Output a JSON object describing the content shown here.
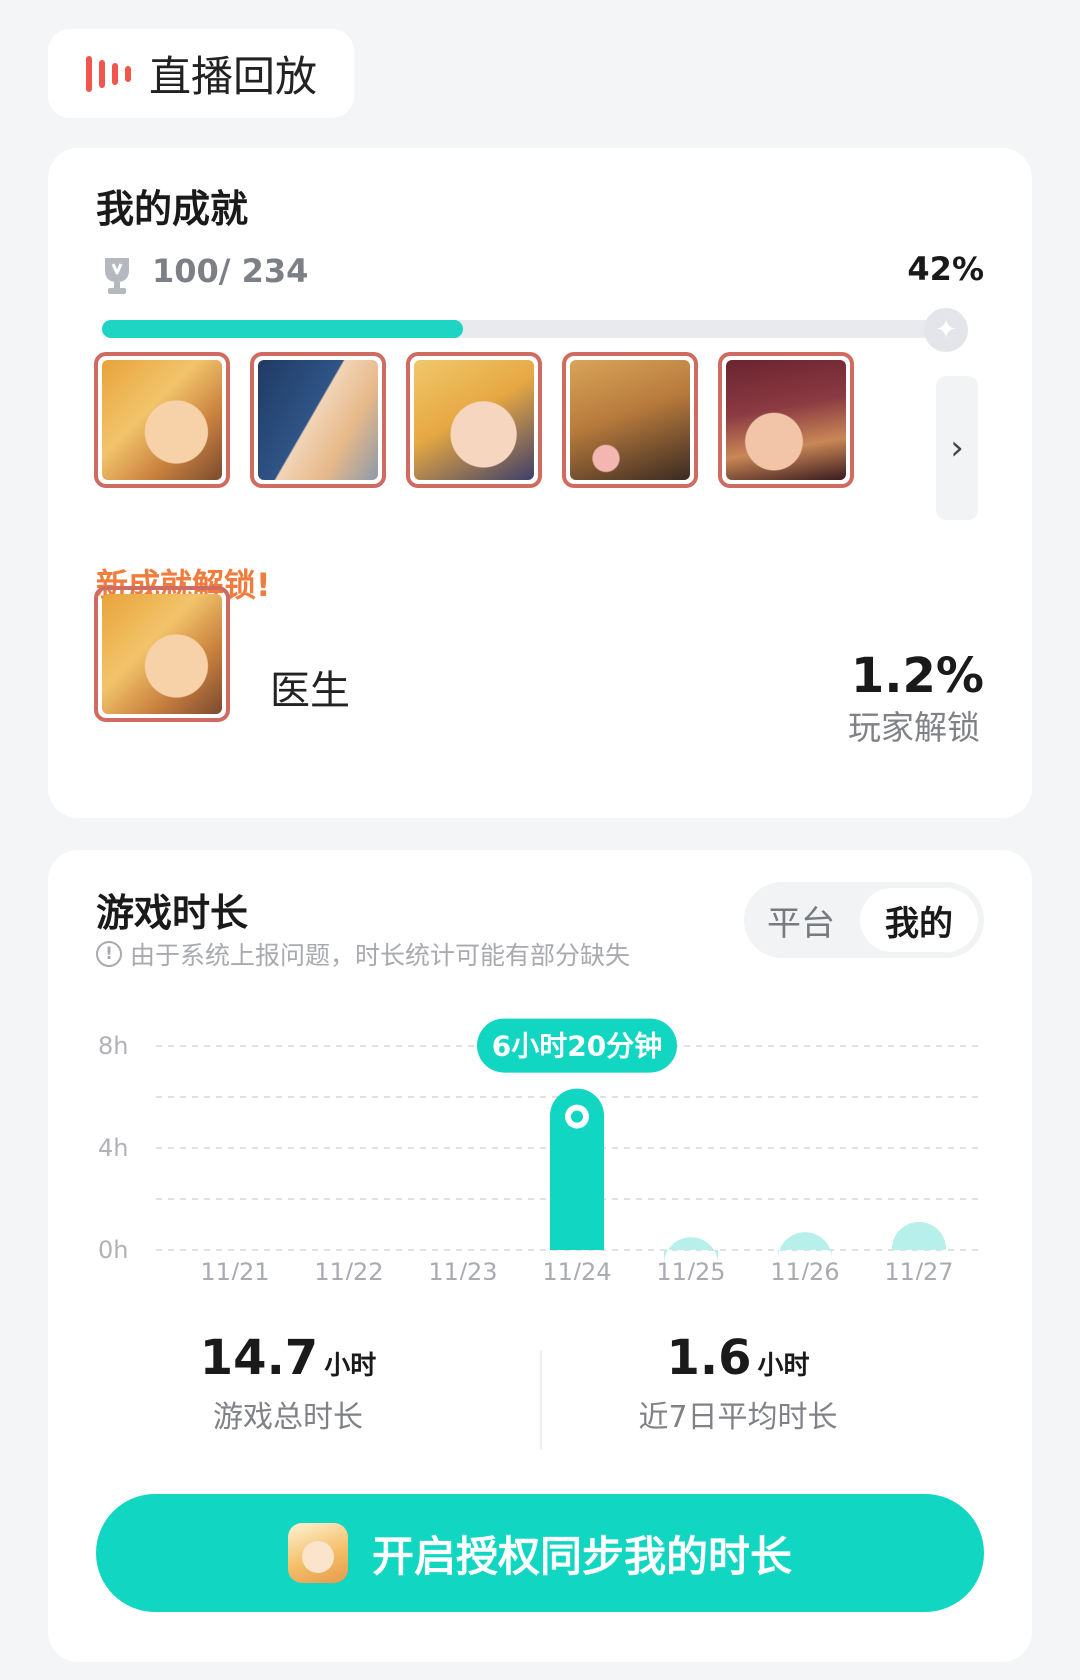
{
  "replay": {
    "label": "直播回放",
    "icon": "live-bars-icon",
    "accent": "#f2554d"
  },
  "achievements": {
    "title": "我的成就",
    "count": "100/ 234",
    "percent_label": "42%",
    "progress": 0.42,
    "progress_color": "#1ed4c2",
    "thumbnails": [
      "achievement-1",
      "achievement-2",
      "achievement-3",
      "achievement-4",
      "achievement-5"
    ],
    "new_unlock": {
      "heading": "新成就解锁!",
      "name": "医生",
      "rate": "1.2%",
      "rate_caption": "玩家解锁"
    }
  },
  "playtime": {
    "title": "游戏时长",
    "notice": "由于系统上报问题，时长统计可能有部分缺失",
    "tabs": {
      "platform": "平台",
      "mine": "我的"
    },
    "tooltip": "6小时20分钟",
    "total": {
      "value": "14.7",
      "unit": "小时",
      "caption": "游戏总时长"
    },
    "average": {
      "value": "1.6",
      "unit": "小时",
      "caption": "近7日平均时长"
    },
    "sync_button": "开启授权同步我的时长",
    "accent": "#10d6c2"
  },
  "chart_data": {
    "type": "bar",
    "categories": [
      "11/21",
      "11/22",
      "11/23",
      "11/24",
      "11/25",
      "11/26",
      "11/27"
    ],
    "values": [
      0,
      0,
      0,
      6.33,
      0.5,
      0.7,
      1.1
    ],
    "yticks": [
      "0h",
      "4h",
      "8h"
    ],
    "ylim": [
      0,
      8
    ],
    "highlight_index": 3,
    "grid": true
  }
}
